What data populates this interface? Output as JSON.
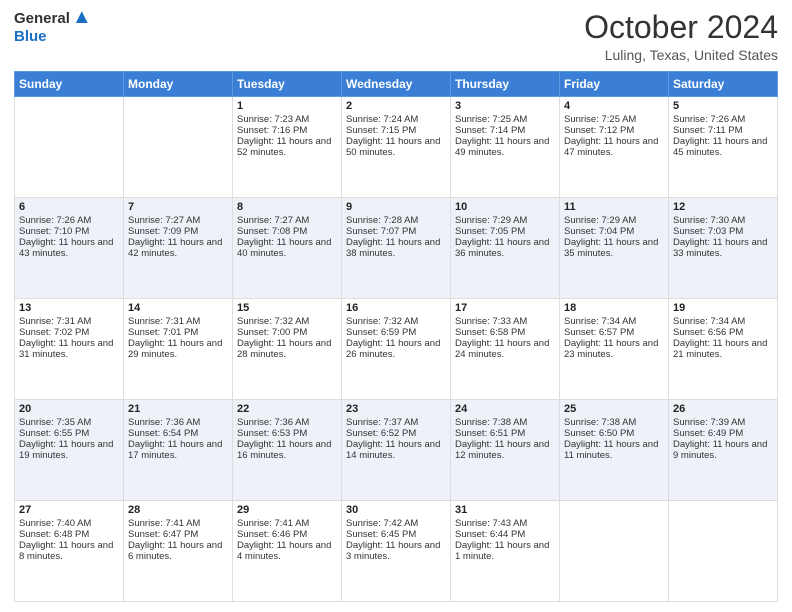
{
  "header": {
    "logo_general": "General",
    "logo_blue": "Blue",
    "month": "October 2024",
    "location": "Luling, Texas, United States"
  },
  "days_of_week": [
    "Sunday",
    "Monday",
    "Tuesday",
    "Wednesday",
    "Thursday",
    "Friday",
    "Saturday"
  ],
  "weeks": [
    [
      {
        "day": "",
        "sunrise": "",
        "sunset": "",
        "daylight": ""
      },
      {
        "day": "",
        "sunrise": "",
        "sunset": "",
        "daylight": ""
      },
      {
        "day": "1",
        "sunrise": "Sunrise: 7:23 AM",
        "sunset": "Sunset: 7:16 PM",
        "daylight": "Daylight: 11 hours and 52 minutes."
      },
      {
        "day": "2",
        "sunrise": "Sunrise: 7:24 AM",
        "sunset": "Sunset: 7:15 PM",
        "daylight": "Daylight: 11 hours and 50 minutes."
      },
      {
        "day": "3",
        "sunrise": "Sunrise: 7:25 AM",
        "sunset": "Sunset: 7:14 PM",
        "daylight": "Daylight: 11 hours and 49 minutes."
      },
      {
        "day": "4",
        "sunrise": "Sunrise: 7:25 AM",
        "sunset": "Sunset: 7:12 PM",
        "daylight": "Daylight: 11 hours and 47 minutes."
      },
      {
        "day": "5",
        "sunrise": "Sunrise: 7:26 AM",
        "sunset": "Sunset: 7:11 PM",
        "daylight": "Daylight: 11 hours and 45 minutes."
      }
    ],
    [
      {
        "day": "6",
        "sunrise": "Sunrise: 7:26 AM",
        "sunset": "Sunset: 7:10 PM",
        "daylight": "Daylight: 11 hours and 43 minutes."
      },
      {
        "day": "7",
        "sunrise": "Sunrise: 7:27 AM",
        "sunset": "Sunset: 7:09 PM",
        "daylight": "Daylight: 11 hours and 42 minutes."
      },
      {
        "day": "8",
        "sunrise": "Sunrise: 7:27 AM",
        "sunset": "Sunset: 7:08 PM",
        "daylight": "Daylight: 11 hours and 40 minutes."
      },
      {
        "day": "9",
        "sunrise": "Sunrise: 7:28 AM",
        "sunset": "Sunset: 7:07 PM",
        "daylight": "Daylight: 11 hours and 38 minutes."
      },
      {
        "day": "10",
        "sunrise": "Sunrise: 7:29 AM",
        "sunset": "Sunset: 7:05 PM",
        "daylight": "Daylight: 11 hours and 36 minutes."
      },
      {
        "day": "11",
        "sunrise": "Sunrise: 7:29 AM",
        "sunset": "Sunset: 7:04 PM",
        "daylight": "Daylight: 11 hours and 35 minutes."
      },
      {
        "day": "12",
        "sunrise": "Sunrise: 7:30 AM",
        "sunset": "Sunset: 7:03 PM",
        "daylight": "Daylight: 11 hours and 33 minutes."
      }
    ],
    [
      {
        "day": "13",
        "sunrise": "Sunrise: 7:31 AM",
        "sunset": "Sunset: 7:02 PM",
        "daylight": "Daylight: 11 hours and 31 minutes."
      },
      {
        "day": "14",
        "sunrise": "Sunrise: 7:31 AM",
        "sunset": "Sunset: 7:01 PM",
        "daylight": "Daylight: 11 hours and 29 minutes."
      },
      {
        "day": "15",
        "sunrise": "Sunrise: 7:32 AM",
        "sunset": "Sunset: 7:00 PM",
        "daylight": "Daylight: 11 hours and 28 minutes."
      },
      {
        "day": "16",
        "sunrise": "Sunrise: 7:32 AM",
        "sunset": "Sunset: 6:59 PM",
        "daylight": "Daylight: 11 hours and 26 minutes."
      },
      {
        "day": "17",
        "sunrise": "Sunrise: 7:33 AM",
        "sunset": "Sunset: 6:58 PM",
        "daylight": "Daylight: 11 hours and 24 minutes."
      },
      {
        "day": "18",
        "sunrise": "Sunrise: 7:34 AM",
        "sunset": "Sunset: 6:57 PM",
        "daylight": "Daylight: 11 hours and 23 minutes."
      },
      {
        "day": "19",
        "sunrise": "Sunrise: 7:34 AM",
        "sunset": "Sunset: 6:56 PM",
        "daylight": "Daylight: 11 hours and 21 minutes."
      }
    ],
    [
      {
        "day": "20",
        "sunrise": "Sunrise: 7:35 AM",
        "sunset": "Sunset: 6:55 PM",
        "daylight": "Daylight: 11 hours and 19 minutes."
      },
      {
        "day": "21",
        "sunrise": "Sunrise: 7:36 AM",
        "sunset": "Sunset: 6:54 PM",
        "daylight": "Daylight: 11 hours and 17 minutes."
      },
      {
        "day": "22",
        "sunrise": "Sunrise: 7:36 AM",
        "sunset": "Sunset: 6:53 PM",
        "daylight": "Daylight: 11 hours and 16 minutes."
      },
      {
        "day": "23",
        "sunrise": "Sunrise: 7:37 AM",
        "sunset": "Sunset: 6:52 PM",
        "daylight": "Daylight: 11 hours and 14 minutes."
      },
      {
        "day": "24",
        "sunrise": "Sunrise: 7:38 AM",
        "sunset": "Sunset: 6:51 PM",
        "daylight": "Daylight: 11 hours and 12 minutes."
      },
      {
        "day": "25",
        "sunrise": "Sunrise: 7:38 AM",
        "sunset": "Sunset: 6:50 PM",
        "daylight": "Daylight: 11 hours and 11 minutes."
      },
      {
        "day": "26",
        "sunrise": "Sunrise: 7:39 AM",
        "sunset": "Sunset: 6:49 PM",
        "daylight": "Daylight: 11 hours and 9 minutes."
      }
    ],
    [
      {
        "day": "27",
        "sunrise": "Sunrise: 7:40 AM",
        "sunset": "Sunset: 6:48 PM",
        "daylight": "Daylight: 11 hours and 8 minutes."
      },
      {
        "day": "28",
        "sunrise": "Sunrise: 7:41 AM",
        "sunset": "Sunset: 6:47 PM",
        "daylight": "Daylight: 11 hours and 6 minutes."
      },
      {
        "day": "29",
        "sunrise": "Sunrise: 7:41 AM",
        "sunset": "Sunset: 6:46 PM",
        "daylight": "Daylight: 11 hours and 4 minutes."
      },
      {
        "day": "30",
        "sunrise": "Sunrise: 7:42 AM",
        "sunset": "Sunset: 6:45 PM",
        "daylight": "Daylight: 11 hours and 3 minutes."
      },
      {
        "day": "31",
        "sunrise": "Sunrise: 7:43 AM",
        "sunset": "Sunset: 6:44 PM",
        "daylight": "Daylight: 11 hours and 1 minute."
      },
      {
        "day": "",
        "sunrise": "",
        "sunset": "",
        "daylight": ""
      },
      {
        "day": "",
        "sunrise": "",
        "sunset": "",
        "daylight": ""
      }
    ]
  ]
}
